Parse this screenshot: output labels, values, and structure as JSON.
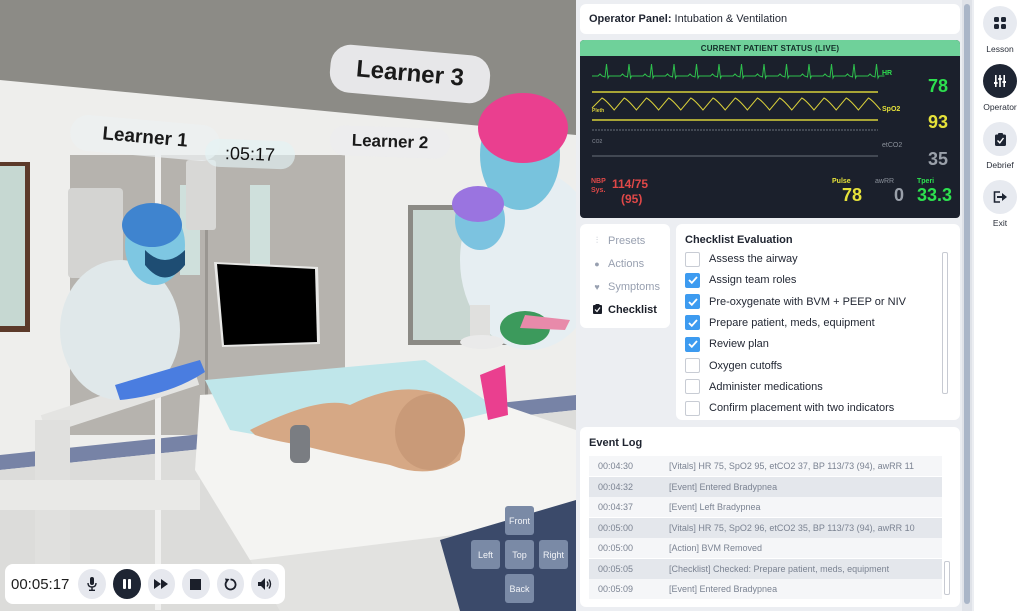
{
  "scene": {
    "learner_tags": [
      "Learner 3",
      "Learner 2",
      "Learner 1"
    ],
    "scene_timer": ":05:17",
    "transport": {
      "elapsed": "00:05:17",
      "buttons": [
        {
          "name": "mic",
          "icon": "microphone-icon",
          "glyph": "🎙"
        },
        {
          "name": "pause",
          "icon": "pause-icon",
          "glyph": "❚❚"
        },
        {
          "name": "fast-forward",
          "icon": "fast-forward-icon",
          "glyph": "⏩"
        },
        {
          "name": "stop",
          "icon": "stop-icon",
          "glyph": "■"
        },
        {
          "name": "restart",
          "icon": "restart-icon",
          "glyph": "↻"
        },
        {
          "name": "volume",
          "icon": "volume-icon",
          "glyph": "🔊"
        }
      ]
    },
    "camera": {
      "front": "Front",
      "left": "Left",
      "top": "Top",
      "right": "Right",
      "back": "Back"
    }
  },
  "panel": {
    "title_bold": "Operator Panel:",
    "title_rest": "Intubation & Ventilation",
    "monitor": {
      "header": "CURRENT PATIENT STATUS (LIVE)",
      "hr_label": "HR",
      "hr": "78",
      "pleth_label": "Pleth",
      "spo2_label": "SpO2",
      "spo2": "93",
      "co2_label": "CO2",
      "etco2_label": "etCO2",
      "etco2": "35",
      "nbp_label": "NBP",
      "sys_label": "Sys.",
      "nbp": "114/75",
      "map": "(95)",
      "pulse_label": "Pulse",
      "pulse": "78",
      "awrr_label": "awRR",
      "awrr": "0",
      "tperi_label": "Tperi",
      "tperi": "33.3",
      "colors": {
        "hr": "#2de04f",
        "spo2": "#e6e23a",
        "etco2": "#9aa0aa",
        "nbp": "#e04848",
        "tperi": "#2de04f"
      }
    },
    "sidenav": [
      {
        "label": "Presets",
        "icon": "sliders-icon",
        "glyph": "⫶",
        "active": false
      },
      {
        "label": "Actions",
        "icon": "actions-icon",
        "glyph": "●",
        "active": false
      },
      {
        "label": "Symptoms",
        "icon": "heart-icon",
        "glyph": "♥",
        "active": false
      },
      {
        "label": "Checklist",
        "icon": "clipboard-icon",
        "glyph": "📋",
        "active": true
      }
    ],
    "checklist": {
      "title": "Checklist Evaluation",
      "items": [
        {
          "label": "Assess the airway",
          "checked": false
        },
        {
          "label": "Assign team roles",
          "checked": true
        },
        {
          "label": "Pre-oxygenate with BVM + PEEP or NIV",
          "checked": true
        },
        {
          "label": "Prepare patient, meds, equipment",
          "checked": true
        },
        {
          "label": "Review plan",
          "checked": true
        },
        {
          "label": "Oxygen cutoffs",
          "checked": false
        },
        {
          "label": "Administer medications",
          "checked": false
        },
        {
          "label": "Confirm placement with two indicators",
          "checked": false
        }
      ]
    },
    "event_log": {
      "title": "Event Log",
      "rows": [
        {
          "time": "00:04:30",
          "text": "[Vitals] HR 75, SpO2 95, etCO2 37, BP 113/73 (94), awRR 11"
        },
        {
          "time": "00:04:32",
          "text": "[Event] Entered Bradypnea"
        },
        {
          "time": "00:04:37",
          "text": "[Event] Left Bradypnea"
        },
        {
          "time": "00:05:00",
          "text": "[Vitals] HR 75, SpO2 96, etCO2 35, BP 113/73 (94), awRR 10"
        },
        {
          "time": "00:05:00",
          "text": "[Action] BVM Removed"
        },
        {
          "time": "00:05:05",
          "text": "[Checklist] Checked: Prepare patient, meds, equipment"
        },
        {
          "time": "00:05:09",
          "text": "[Event] Entered Bradypnea"
        }
      ]
    }
  },
  "rail": [
    {
      "label": "Lesson",
      "icon": "grid-icon",
      "glyph": "▦",
      "active": false
    },
    {
      "label": "Operator",
      "icon": "sliders-icon",
      "glyph": "⫶",
      "active": true
    },
    {
      "label": "Debrief",
      "icon": "clipboard-check-icon",
      "glyph": "📋",
      "active": false
    },
    {
      "label": "Exit",
      "icon": "exit-icon",
      "glyph": "⇥",
      "active": false
    }
  ]
}
